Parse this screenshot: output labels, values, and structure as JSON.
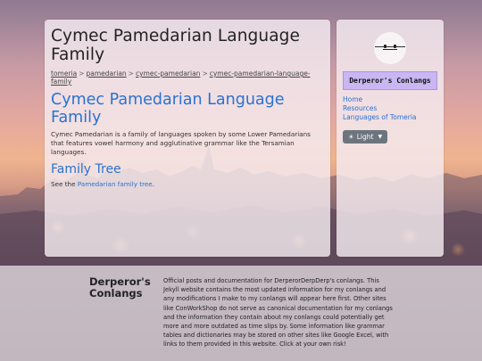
{
  "page": {
    "title": "Cymec Pamedarian Language Family",
    "breadcrumb": [
      "tomeria",
      "pamedarian",
      "cymec-pamedarian",
      "cymec-pamedarian-language-family"
    ],
    "breadcrumb_sep": ">",
    "heading": "Cymec Pamedarian Language Family",
    "intro": "Cymec Pamedarian is a family of languages spoken by some Lower Pamedarians that features vowel harmony and agglutinative grammar like the Tersamian languages.",
    "section_title": "Family Tree",
    "see_prefix": "See the ",
    "see_link": "Pamedarian family tree",
    "see_suffix": "."
  },
  "sidebar": {
    "brand": "Derperor's Conlangs",
    "nav": [
      "Home",
      "Resources",
      "Languages of Tomeria"
    ],
    "theme_icon": "sun-icon",
    "theme_label": "Light"
  },
  "footer": {
    "title": "Derperor's Conlangs",
    "text": "Official posts and documentation for DerperorDerpDerp's conlangs. This Jekyll website contains the most updated information for my conlangs and any modifications I make to my conlangs will appear here first. Other sites like ConWorkShop do not serve as canonical documentation for my conlangs and the information they contain about my conlangs could potentially get more and more outdated as time slips by. Some information like grammar tables and dictionaries may be stored on other sites like Google Excel, with links to them provided in this website. Click at your own risk!"
  },
  "colors": {
    "accent": "#2a72d0",
    "brand_bg": "#c9b6f2",
    "button_bg": "#6c757d"
  }
}
